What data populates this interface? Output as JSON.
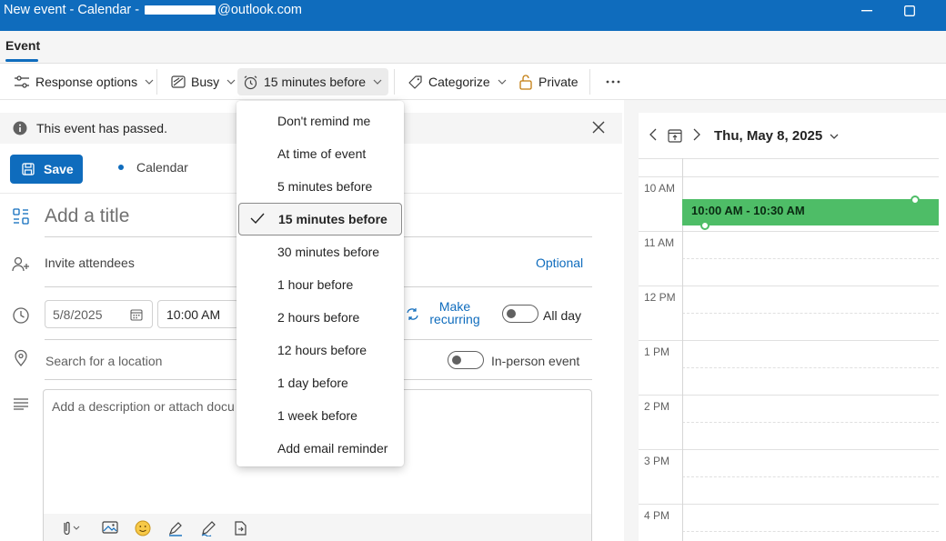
{
  "window": {
    "title_prefix": "New event - Calendar - ",
    "title_suffix": "@outlook.com"
  },
  "tabs": {
    "active": "Event"
  },
  "toolbar": {
    "response_options": "Response options",
    "busy": "Busy",
    "reminder": "15 minutes before",
    "categorize": "Categorize",
    "private": "Private"
  },
  "reminder_menu": {
    "items": [
      "Don't remind me",
      "At time of event",
      "5 minutes before",
      "15 minutes before",
      "30 minutes before",
      "1 hour before",
      "2 hours before",
      "12 hours before",
      "1 day before",
      "1 week before",
      "Add email reminder"
    ],
    "selected": "15 minutes before"
  },
  "banner": {
    "text": "This event has passed."
  },
  "form": {
    "save_label": "Save",
    "calendar_label": "Calendar",
    "title_placeholder": "Add a title",
    "attendees_placeholder": "Invite attendees",
    "optional_label": "Optional",
    "date": "5/8/2025",
    "time": "10:00 AM",
    "make_recurring_line1": "Make",
    "make_recurring_line2": "recurring",
    "all_day_label": "All day",
    "all_day_on": false,
    "location_placeholder": "Search for a location",
    "in_person_label": "In-person event",
    "in_person_on": false,
    "description_placeholder": "Add a description or attach docu"
  },
  "day_view": {
    "date_label": "Thu, May 8, 2025",
    "hours": [
      "10 AM",
      "11 AM",
      "12 PM",
      "1 PM",
      "2 PM",
      "3 PM",
      "4 PM"
    ],
    "event": {
      "time_range": "10:00 AM - 10:30 AM",
      "color": "#4ebd67"
    }
  },
  "colors": {
    "accent": "#0f6cbd",
    "titlebar": "#0f6cbd",
    "event_green": "#4ebd67"
  },
  "icons": [
    "minimize-icon",
    "maximize-icon",
    "sliders-icon",
    "busy-icon",
    "alarm-clock-icon",
    "tag-icon",
    "lock-open-icon",
    "more-icon",
    "info-icon",
    "close-icon",
    "save-icon",
    "title-icon",
    "attendees-icon",
    "clock-icon",
    "calendar-icon",
    "recurring-icon",
    "location-icon",
    "description-icon",
    "checkmark-icon",
    "attach-icon",
    "image-icon",
    "emoji-icon",
    "highlighter-icon",
    "pen-icon",
    "loop-icon",
    "chevron-left-icon",
    "chevron-right-icon",
    "today-icon"
  ]
}
